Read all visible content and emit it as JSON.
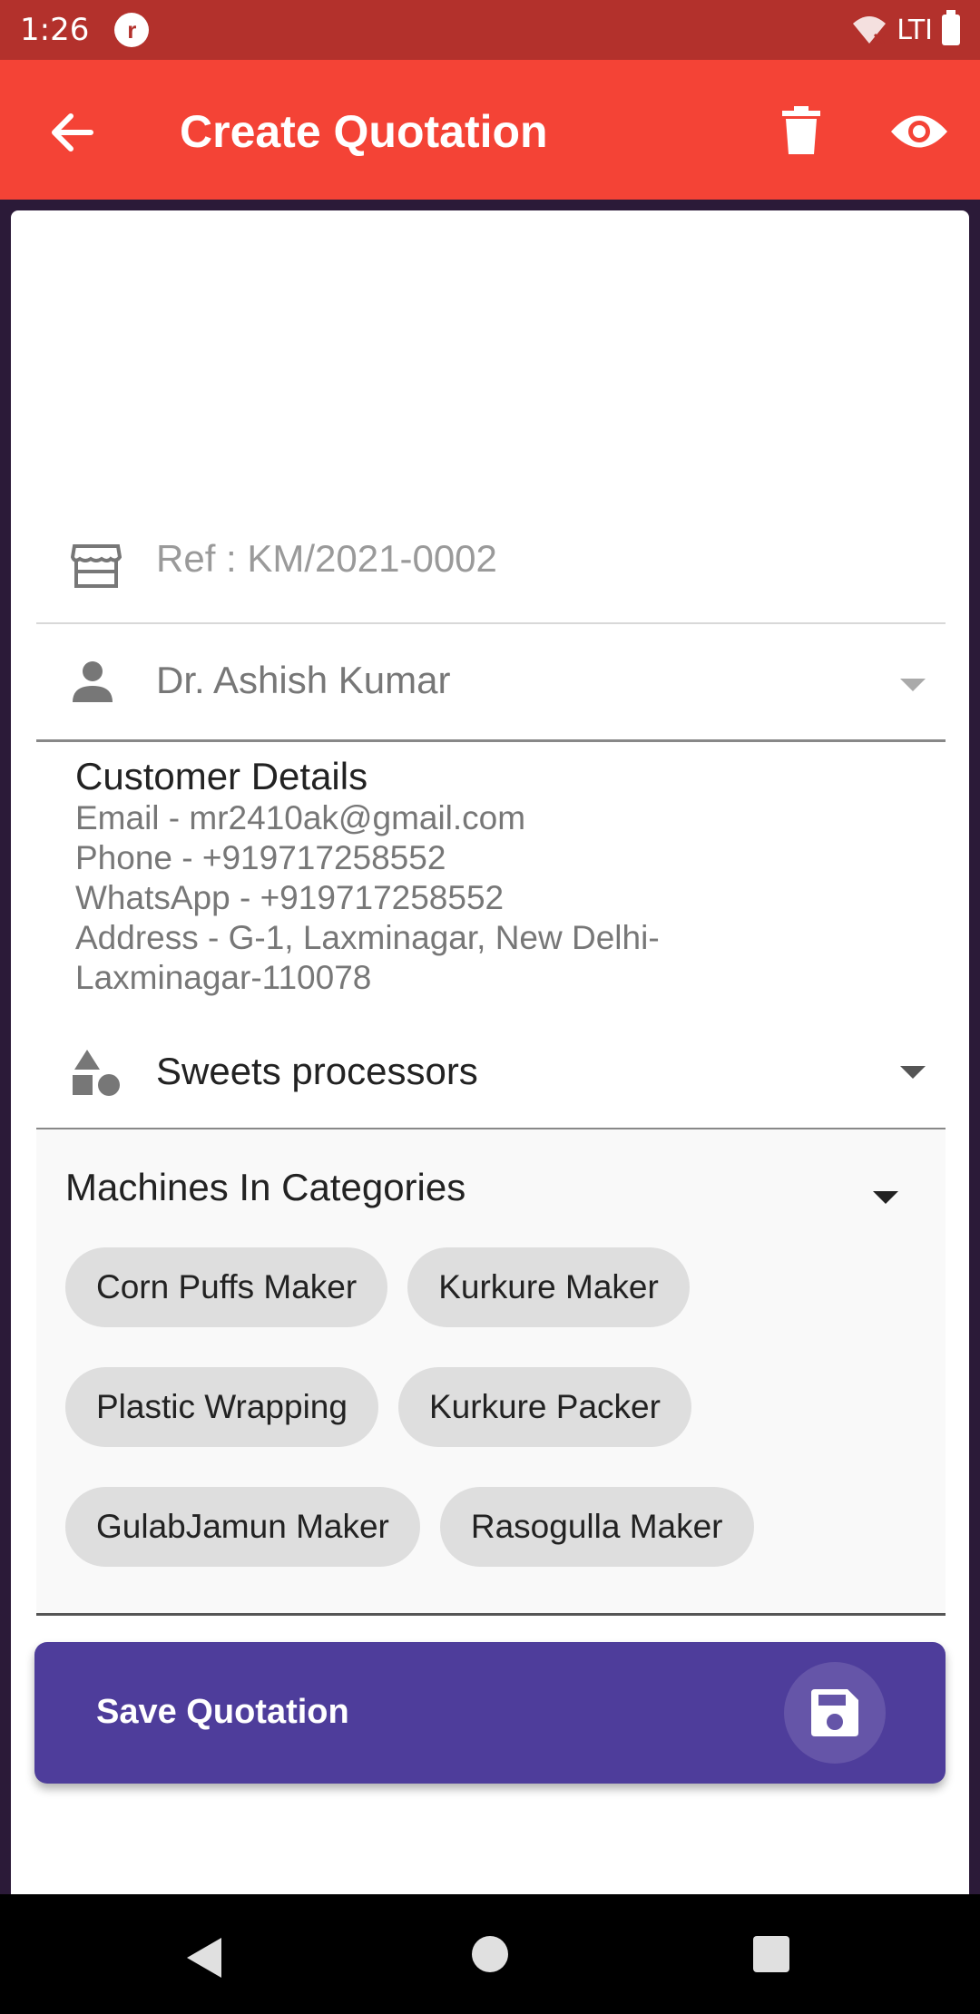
{
  "status_bar": {
    "time": "1:26",
    "app_badge": "r",
    "network": "LTI"
  },
  "app_bar": {
    "title": "Create Quotation"
  },
  "form": {
    "ref": "Ref : KM/2021-0002",
    "customer": "Dr. Ashish Kumar",
    "customer_details": {
      "heading": "Customer Details",
      "email": "Email - mr2410ak@gmail.com",
      "phone": "Phone - +919717258552",
      "whatsapp": "WhatsApp - +919717258552",
      "address_line1": "Address - G-1, Laxminagar, New Delhi-",
      "address_line2": "Laxminagar-110078"
    },
    "category": "Sweets processors",
    "machines_title": "Machines In Categories",
    "machines": [
      "Corn Puffs Maker",
      "Kurkure Maker",
      "Plastic Wrapping",
      "Kurkure Packer",
      "GulabJamun Maker",
      "Rasogulla Maker"
    ],
    "save_label": "Save Quotation"
  },
  "colors": {
    "app_bar": "#f44336",
    "status_bar": "#b3312c",
    "save_button": "#4e3d9b"
  }
}
